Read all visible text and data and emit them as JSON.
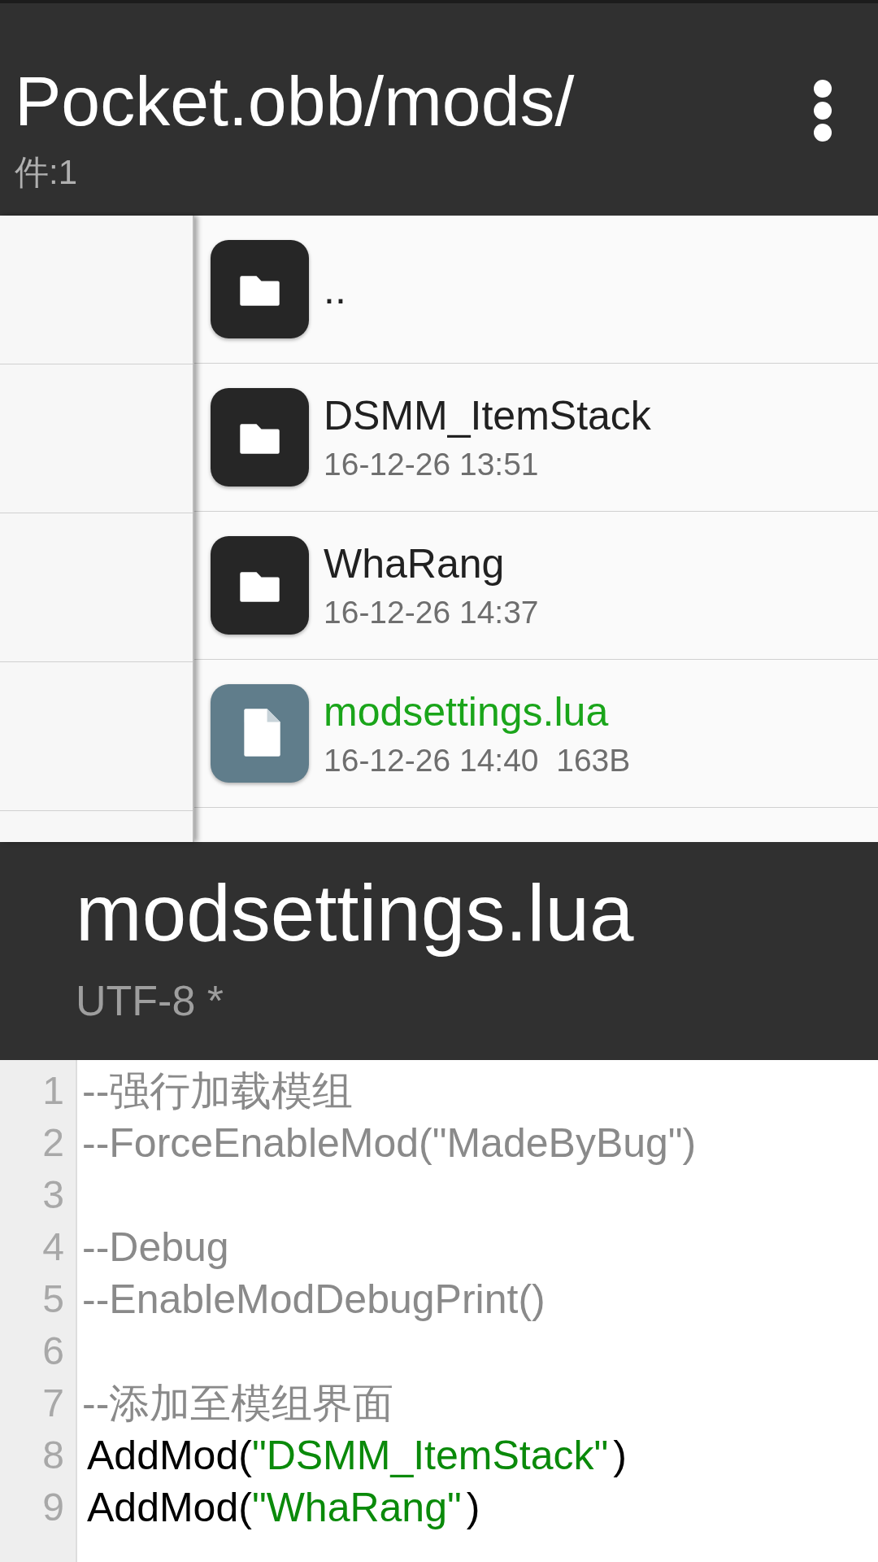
{
  "toolbar": {
    "title": "Pocket.obb/mods/",
    "subtitle": "件:1"
  },
  "files": [
    {
      "kind": "folder",
      "name": "..",
      "color": "#212121"
    },
    {
      "kind": "folder",
      "name": "DSMM_ItemStack",
      "details": "16-12-26 13:51",
      "color": "#212121"
    },
    {
      "kind": "folder",
      "name": "WhaRang",
      "details": "16-12-26 14:37",
      "color": "#212121"
    },
    {
      "kind": "file",
      "name": "modsettings.lua",
      "details": "16-12-26 14:40  163B",
      "color": "#1aa51a"
    }
  ],
  "editor": {
    "title": "modsettings.lua",
    "encoding": "UTF-8 *",
    "lines": [
      {
        "number": "1",
        "segments": [
          {
            "kind": "comment",
            "text": "--强行加载模组"
          }
        ]
      },
      {
        "number": "2",
        "segments": [
          {
            "kind": "comment",
            "text": "--ForceEnableMod(\"MadeByBug\")"
          }
        ]
      },
      {
        "number": "3"
      },
      {
        "number": "4",
        "segments": [
          {
            "kind": "comment",
            "text": "--Debug"
          }
        ]
      },
      {
        "number": "5",
        "segments": [
          {
            "kind": "comment",
            "text": "--EnableModDebugPrint()"
          }
        ]
      },
      {
        "number": "6"
      },
      {
        "number": "7",
        "segments": [
          {
            "kind": "comment",
            "text": "--添加至模组界面"
          }
        ]
      },
      {
        "number": "8",
        "segments": [
          {
            "kind": "code",
            "text": "AddMod("
          },
          {
            "kind": "string",
            "text": "\"DSMM_ItemStack\""
          },
          {
            "kind": "code",
            "text": ")"
          }
        ]
      },
      {
        "number": "9",
        "segments": [
          {
            "kind": "code",
            "text": "AddMod("
          },
          {
            "kind": "string",
            "text": "\"WhaRang\""
          },
          {
            "kind": "code",
            "text": ")"
          }
        ]
      }
    ]
  }
}
